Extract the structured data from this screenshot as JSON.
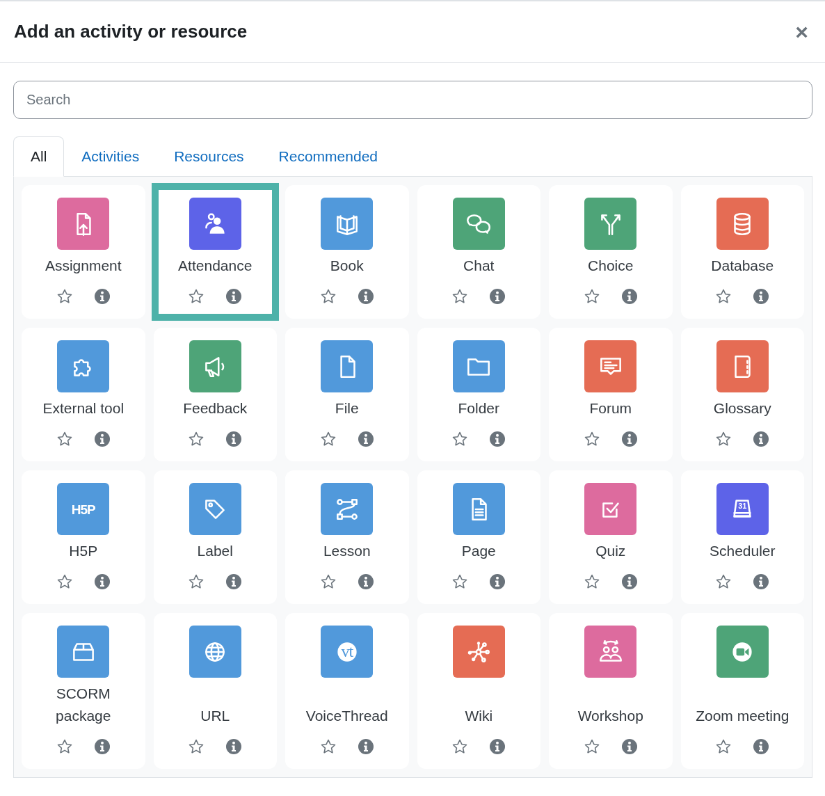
{
  "dialog": {
    "title": "Add an activity or resource",
    "close": "×"
  },
  "search": {
    "placeholder": "Search"
  },
  "tabs": [
    {
      "label": "All",
      "selected": true
    },
    {
      "label": "Activities",
      "selected": false
    },
    {
      "label": "Resources",
      "selected": false
    },
    {
      "label": "Recommended",
      "selected": false
    }
  ],
  "items": [
    {
      "name": "Assignment",
      "kind": "assign",
      "color": "#dd6b9e",
      "selected": false,
      "starred": false
    },
    {
      "name": "Attendance",
      "kind": "attendance",
      "color": "#5d63e8",
      "selected": true,
      "starred": false
    },
    {
      "name": "Book",
      "kind": "book",
      "color": "#5199db",
      "selected": false,
      "starred": false
    },
    {
      "name": "Chat",
      "kind": "chat",
      "color": "#4ea478",
      "selected": false,
      "starred": false
    },
    {
      "name": "Choice",
      "kind": "choice",
      "color": "#4ea478",
      "selected": false,
      "starred": false
    },
    {
      "name": "Database",
      "kind": "database",
      "color": "#e56c54",
      "selected": false,
      "starred": false
    },
    {
      "name": "External tool",
      "kind": "lti",
      "color": "#5199db",
      "selected": false,
      "starred": false
    },
    {
      "name": "Feedback",
      "kind": "feedback",
      "color": "#4ea478",
      "selected": false,
      "starred": false
    },
    {
      "name": "File",
      "kind": "file",
      "color": "#5199db",
      "selected": false,
      "starred": false
    },
    {
      "name": "Folder",
      "kind": "folder",
      "color": "#5199db",
      "selected": false,
      "starred": false
    },
    {
      "name": "Forum",
      "kind": "forum",
      "color": "#e56c54",
      "selected": false,
      "starred": false
    },
    {
      "name": "Glossary",
      "kind": "glossary",
      "color": "#e56c54",
      "selected": false,
      "starred": false
    },
    {
      "name": "H5P",
      "kind": "h5p",
      "color": "#5199db",
      "icon_text": "H5P",
      "selected": false,
      "starred": false
    },
    {
      "name": "Label",
      "kind": "label",
      "color": "#5199db",
      "selected": false,
      "starred": false
    },
    {
      "name": "Lesson",
      "kind": "lesson",
      "color": "#5199db",
      "selected": false,
      "starred": false
    },
    {
      "name": "Page",
      "kind": "page",
      "color": "#5199db",
      "selected": false,
      "starred": false
    },
    {
      "name": "Quiz",
      "kind": "quiz",
      "color": "#dd6b9e",
      "selected": false,
      "starred": false
    },
    {
      "name": "Scheduler",
      "kind": "scheduler",
      "color": "#5d63e8",
      "icon_text": "31",
      "selected": false,
      "starred": false
    },
    {
      "name": "SCORM package",
      "kind": "scorm",
      "color": "#5199db",
      "selected": false,
      "starred": false
    },
    {
      "name": "URL",
      "kind": "url",
      "color": "#5199db",
      "selected": false,
      "starred": false
    },
    {
      "name": "VoiceThread",
      "kind": "voicethread",
      "color": "#5199db",
      "icon_text": "vt",
      "selected": false,
      "starred": false
    },
    {
      "name": "Wiki",
      "kind": "wiki",
      "color": "#e56c54",
      "selected": false,
      "starred": false
    },
    {
      "name": "Workshop",
      "kind": "workshop",
      "color": "#dd6b9e",
      "selected": false,
      "starred": false
    },
    {
      "name": "Zoom meeting",
      "kind": "zoom",
      "color": "#4ea478",
      "selected": false,
      "starred": false
    }
  ]
}
